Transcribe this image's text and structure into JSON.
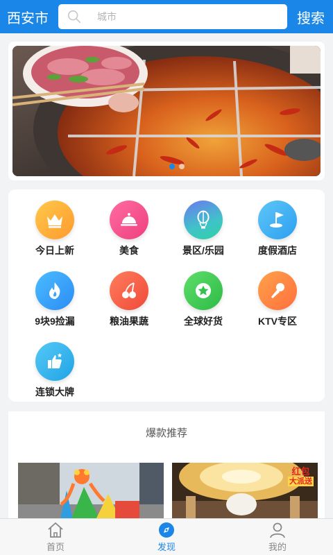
{
  "header": {
    "city": "西安市",
    "search_placeholder": "城市",
    "search_label": "搜索"
  },
  "banner": {
    "slides": 2,
    "active_index": 0
  },
  "categories": [
    {
      "label": "今日上新",
      "icon": "crown-icon",
      "color": "#ffb13d"
    },
    {
      "label": "美食",
      "icon": "cloche-icon",
      "color": "#f9508f"
    },
    {
      "label": "景区/乐园",
      "icon": "hot-air-balloon-icon",
      "color": "#39c6c6"
    },
    {
      "label": "度假酒店",
      "icon": "golf-flag-icon",
      "color": "#3fb1ef"
    },
    {
      "label": "9块9捡漏",
      "icon": "flame-icon",
      "color": "#36a5ff"
    },
    {
      "label": "粮油果蔬",
      "icon": "cherry-icon",
      "color": "#ff6a4d"
    },
    {
      "label": "全球好货",
      "icon": "star-icon",
      "color": "#3fcf55"
    },
    {
      "label": "KTV专区",
      "icon": "microphone-icon",
      "color": "#ff8a3d"
    },
    {
      "label": "连锁大牌",
      "icon": "thumbs-up-icon",
      "color": "#2fb2ef"
    }
  ],
  "hot": {
    "title": "爆款推荐"
  },
  "products": [
    {
      "image": "inflatable-castle-photo"
    },
    {
      "image": "banquet-hall-photo",
      "badge_line1": "红包",
      "badge_line2": "大派送"
    }
  ],
  "tabbar": [
    {
      "label": "首页",
      "icon": "home-icon",
      "active": false
    },
    {
      "label": "发现",
      "icon": "discover-icon",
      "active": true
    },
    {
      "label": "我的",
      "icon": "user-icon",
      "active": false
    }
  ],
  "colors": {
    "primary": "#1a86e8",
    "background": "#f2f3f5"
  }
}
